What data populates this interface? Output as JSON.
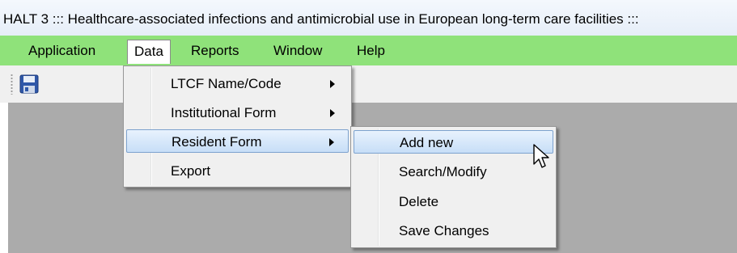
{
  "window": {
    "title": "HALT 3 ::: Healthcare-associated infections and antimicrobial use in European long-term care facilities :::"
  },
  "menubar": {
    "items": [
      {
        "label": "Application"
      },
      {
        "label": "Data"
      },
      {
        "label": "Reports"
      },
      {
        "label": "Window"
      },
      {
        "label": "Help"
      }
    ]
  },
  "toolbar": {
    "save_icon": "save-icon"
  },
  "data_menu": {
    "items": [
      {
        "label": "LTCF Name/Code",
        "has_submenu": true
      },
      {
        "label": "Institutional Form",
        "has_submenu": true
      },
      {
        "label": "Resident Form",
        "has_submenu": true,
        "highlighted": true
      },
      {
        "label": "Export",
        "has_submenu": false
      }
    ]
  },
  "resident_submenu": {
    "items": [
      {
        "label": "Add new",
        "highlighted": true
      },
      {
        "label": "Search/Modify"
      },
      {
        "label": "Delete"
      },
      {
        "label": "Save Changes"
      }
    ]
  },
  "colors": {
    "menubar_bg": "#8fe27a",
    "client_bg": "#ababab",
    "highlight_border": "#7da2ce"
  }
}
